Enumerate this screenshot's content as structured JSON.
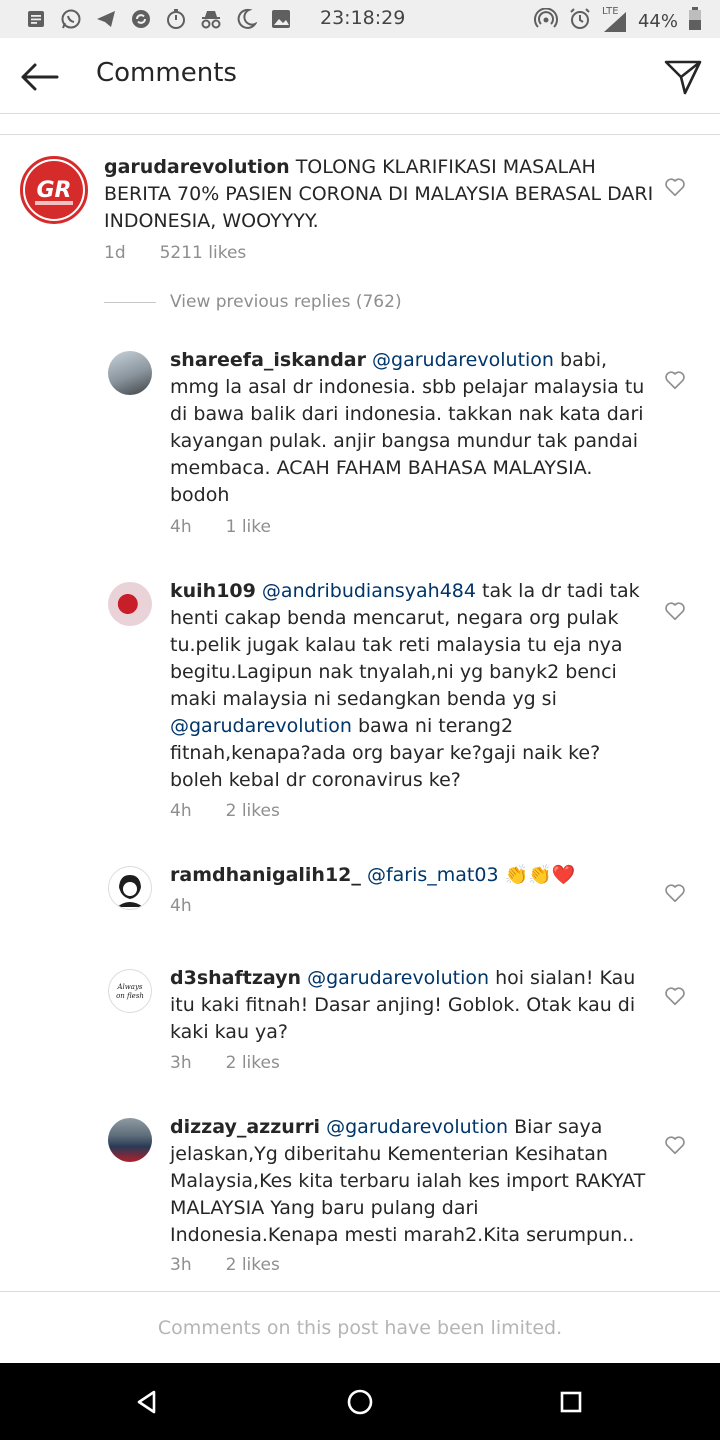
{
  "status_bar": {
    "time": "23:18:29",
    "network": "LTE",
    "battery": "44%",
    "left_icons": [
      "notification-icon",
      "whatsapp-icon",
      "telegram-icon",
      "sync-icon",
      "stopwatch-icon",
      "incognito-icon",
      "moon-icon",
      "image-icon"
    ],
    "right_icons": [
      "hotspot-icon",
      "alarm-icon",
      "signal-icon",
      "battery-icon"
    ]
  },
  "header": {
    "title": "Comments"
  },
  "original_post": {
    "username": "garudarevolution",
    "text": " TOLONG KLARIFIKASI MASALAH BERITA 70% PASIEN CORONA DI MALAYSIA BERASAL DARI INDONESIA, WOOYYYY.",
    "time": "1d",
    "likes": "5211 likes",
    "avatar_text": "GR"
  },
  "view_previous_replies": "View previous replies (762)",
  "replies": [
    {
      "username": "shareefa_iskandar",
      "mention": "@garudarevolution",
      "text": " babi, mmg la asal dr indonesia. sbb pelajar malaysia tu di bawa balik dari indonesia. takkan nak kata dari kayangan pulak. anjir bangsa mundur tak pandai membaca. ACAH FAHAM BAHASA MALAYSIA. bodoh",
      "time": "4h",
      "likes": "1 like"
    },
    {
      "username": "kuih109",
      "mention": "@andribudiansyah484",
      "text": " tak la dr tadi tak henti cakap benda mencarut, negara org pulak tu.pelik jugak kalau tak reti malaysia tu eja nya begitu.Lagipun nak tnyalah,ni yg banyk2 benci maki malaysia ni sedangkan benda yg si ",
      "mention2": "@garudarevolution",
      "text2": " bawa ni terang2 fitnah,kenapa?ada org bayar ke?gaji naik ke? boleh kebal dr coronavirus ke?",
      "time": "4h",
      "likes": "2 likes"
    },
    {
      "username": "ramdhanigalih12_",
      "mention": "@faris_mat03",
      "text": " 👏👏❤️",
      "time": "4h",
      "likes": ""
    },
    {
      "username": "d3shaftzayn",
      "mention": "@garudarevolution",
      "text": " hoi sialan! Kau itu kaki fitnah! Dasar anjing! Goblok. Otak kau di kaki kau ya?",
      "time": "3h",
      "likes": "2 likes",
      "avatar_text": "Always on Flesh"
    },
    {
      "username": "dizzay_azzurri",
      "mention": "@garudarevolution",
      "text": "  Biar saya jelaskan,Yg diberitahu Kementerian Kesihatan Malaysia,Kes kita terbaru ialah kes import RAKYAT MALAYSIA Yang baru pulang dari Indonesia.Kenapa mesti marah2.Kita serumpun..",
      "time": "3h",
      "likes": "2 likes"
    }
  ],
  "footer": {
    "limited_text": "Comments on this post have been limited."
  },
  "colors": {
    "mention": "#003569",
    "meta": "#8e8e8e",
    "divider": "#dbdbdb",
    "gr_red": "#d62b2b"
  }
}
